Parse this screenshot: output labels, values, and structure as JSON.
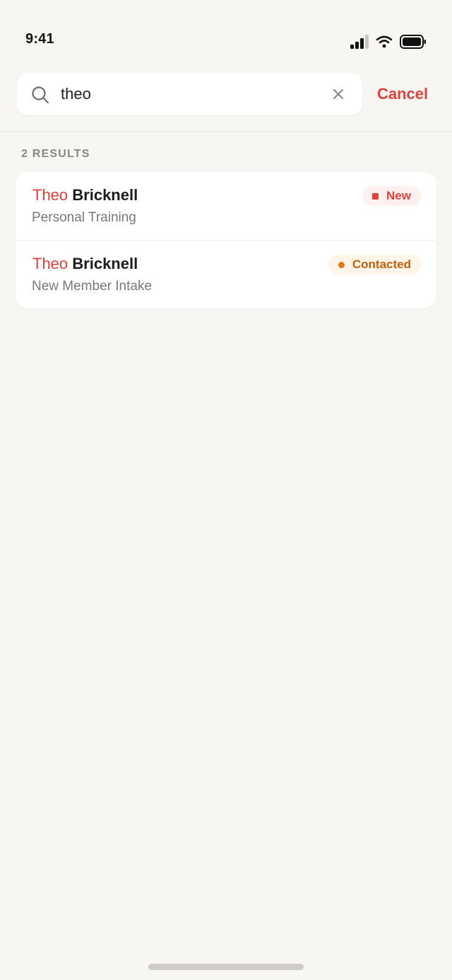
{
  "status_bar": {
    "time": "9:41",
    "icons": [
      "signal-icon",
      "wifi-icon",
      "battery-icon"
    ]
  },
  "search": {
    "value": "theo",
    "placeholder": "Search",
    "cancel_label": "Cancel"
  },
  "results": {
    "count_label": "2 RESULTS",
    "items": [
      {
        "name_match": "Theo",
        "name_rest": " Bricknell",
        "subtitle": "Personal Training",
        "status": "New",
        "status_color": "#e0413c"
      },
      {
        "name_match": "Theo",
        "name_rest": " Bricknell",
        "subtitle": "New Member Intake",
        "status": "Contacted",
        "status_color": "#c0620d"
      }
    ]
  },
  "colors": {
    "accent": "#e0413c",
    "background": "#f8f6f2",
    "contacted": "#c0620d"
  }
}
